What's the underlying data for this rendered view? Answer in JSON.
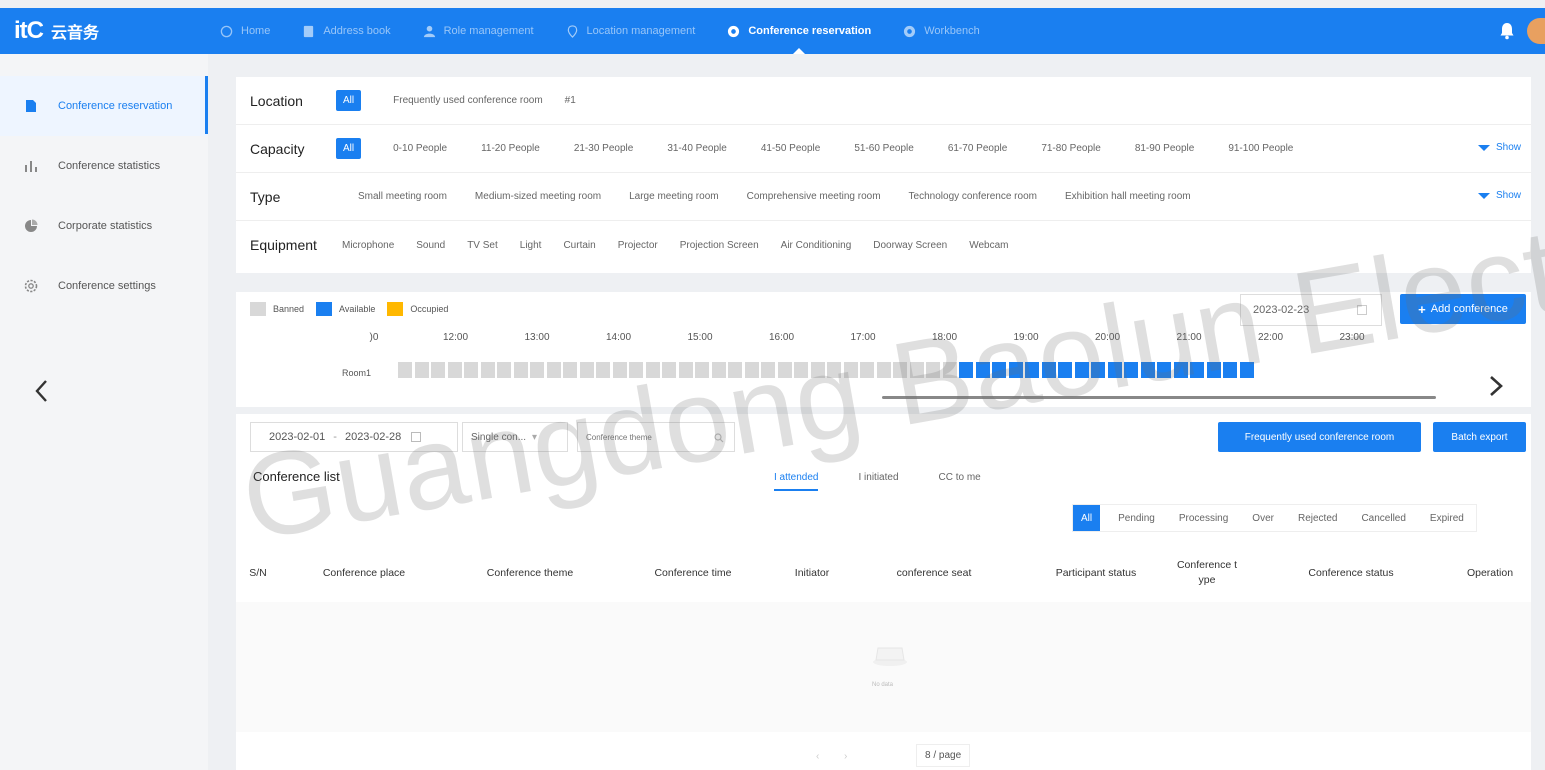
{
  "header": {
    "logo_text": "itC",
    "logo_cn": "云音务",
    "nav": [
      {
        "label": "Home"
      },
      {
        "label": "Address book"
      },
      {
        "label": "Role management"
      },
      {
        "label": "Location management"
      },
      {
        "label": "Conference reservation"
      },
      {
        "label": "Workbench"
      }
    ]
  },
  "sidebar": {
    "items": [
      {
        "label": "Conference reservation"
      },
      {
        "label": "Conference statistics"
      },
      {
        "label": "Corporate statistics"
      },
      {
        "label": "Conference settings"
      }
    ]
  },
  "filters": {
    "location": {
      "label": "Location",
      "options": [
        "All",
        "Frequently used conference room",
        "#1"
      ]
    },
    "capacity": {
      "label": "Capacity",
      "options": [
        "All",
        "0-10 People",
        "11-20 People",
        "21-30 People",
        "31-40 People",
        "41-50 People",
        "51-60 People",
        "61-70 People",
        "71-80 People",
        "81-90 People",
        "91-100 People"
      ],
      "show": "Show"
    },
    "type": {
      "label": "Type",
      "options": [
        "Small meeting room",
        "Medium-sized meeting room",
        "Large meeting room",
        "Comprehensive meeting room",
        "Technology conference room",
        "Exhibition hall meeting room"
      ],
      "show": "Show"
    },
    "equipment": {
      "label": "Equipment",
      "options": [
        "Microphone",
        "Sound",
        "TV Set",
        "Light",
        "Curtain",
        "Projector",
        "Projection Screen",
        "Air Conditioning",
        "Doorway Screen",
        "Webcam"
      ]
    }
  },
  "timeline": {
    "legend": [
      "Banned",
      "Available",
      "Occupied"
    ],
    "date": "2023-02-23",
    "add_button": "Add conference",
    "hours": [
      ")0",
      "12:00",
      "13:00",
      "14:00",
      "15:00",
      "16:00",
      "17:00",
      "18:00",
      "19:00",
      "20:00",
      "21:00",
      "22:00",
      "23:00"
    ],
    "room": "Room1",
    "slots": [
      {
        "state": "banned",
        "count": 34
      },
      {
        "state": "available",
        "count": 18
      }
    ]
  },
  "list": {
    "date_from": "2023-02-01",
    "date_sep": "-",
    "date_to": "2023-02-28",
    "conference_type": "Single con...",
    "theme_placeholder": "Conference theme",
    "freq_button": "Frequently used conference room",
    "export_button": "Batch export",
    "title": "Conference list",
    "role_tabs": [
      "I attended",
      "I initiated",
      "CC to me"
    ],
    "status_tabs": [
      "All",
      "Pending",
      "Processing",
      "Over",
      "Rejected",
      "Cancelled",
      "Expired"
    ],
    "columns": [
      "S/N",
      "Conference place",
      "Conference theme",
      "Conference time",
      "Initiator",
      "conference seat",
      "Participant status",
      "Conference t ype",
      "Conference status",
      "Operation"
    ],
    "empty_text": "No data",
    "page_size": "8 / page"
  },
  "watermark": "Guangdong Baolun Electro",
  "colors": {
    "primary": "#1a7ff0",
    "occupied": "#ffb800",
    "banned": "#d8d8d8"
  }
}
